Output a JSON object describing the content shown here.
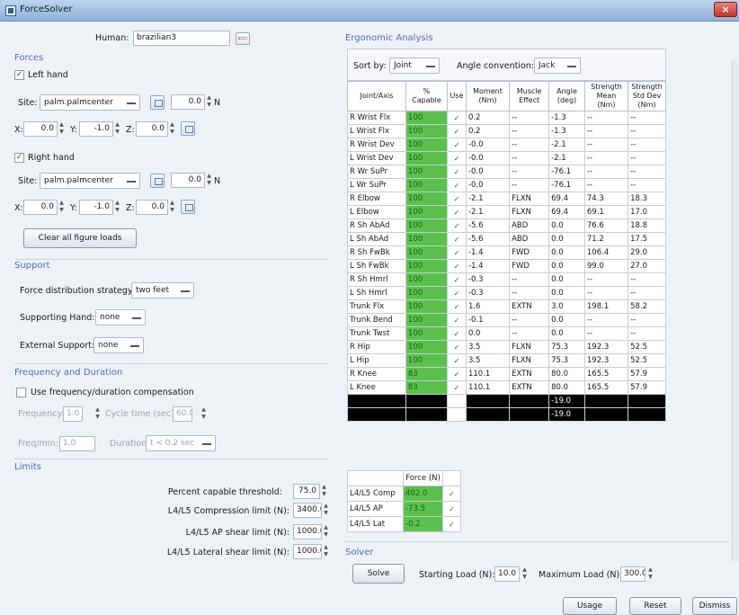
{
  "window": {
    "title": "ForceSolver",
    "close_glyph": "×"
  },
  "human": {
    "label": "Human:",
    "value": "brazilian3"
  },
  "forces": {
    "section": "Forces",
    "left_hand": {
      "label": "Left hand",
      "checked": true,
      "site_label": "Site:",
      "site": "palm.palmcenter",
      "force": "0.0",
      "unit": "N",
      "x_label": "X:",
      "x": "0.0",
      "y_label": "Y:",
      "y": "-1.0",
      "z_label": "Z:",
      "z": "0.0"
    },
    "right_hand": {
      "label": "Right hand",
      "checked": true,
      "site_label": "Site:",
      "site": "palm.palmcenter",
      "force": "0.0",
      "unit": "N",
      "x_label": "X:",
      "x": "0.0",
      "y_label": "Y:",
      "y": "-1.0",
      "z_label": "Z:",
      "z": "0.0"
    },
    "clear_button": "Clear all figure loads"
  },
  "support": {
    "section": "Support",
    "strategy_label": "Force distribution strategy:",
    "strategy": "two feet",
    "hand_label": "Supporting Hand:",
    "hand": "none",
    "external_label": "External Support:",
    "external": "none"
  },
  "frequency": {
    "section": "Frequency and Duration",
    "use_label": "Use frequency/duration compensation",
    "frequency_label": "Frequency:",
    "frequency": "1.0",
    "cycle_label": "Cycle time (sec):",
    "cycle": "60.0",
    "freq_min_label": "Freq/min:",
    "freq_min": "1.0",
    "duration_label": "Duration:",
    "duration": "t < 0.2 sec"
  },
  "limits": {
    "section": "Limits",
    "threshold_label": "Percent capable threshold:",
    "threshold": "75.0",
    "compression_label": "L4/L5 Compression limit (N):",
    "compression": "3400.0",
    "ap_label": "L4/L5 AP shear limit (N):",
    "ap": "1000.0",
    "lateral_label": "L4/L5 Lateral shear limit (N):",
    "lateral": "1000.0"
  },
  "ergonomic": {
    "section": "Ergonomic Analysis",
    "sort_label": "Sort by:",
    "sort": "Joint",
    "angle_label": "Angle convention:",
    "angle": "Jack",
    "headers": [
      "Joint/Axis",
      "% Capable",
      "Use",
      "Moment (Nm)",
      "Muscle Effect",
      "Angle (deg)",
      "Strength Mean (Nm)",
      "Strength Std Dev (Nm)"
    ],
    "rows": [
      [
        "R Wrist Flx",
        "100",
        "✓",
        "0.2",
        "--",
        "-1.3",
        "--",
        "--"
      ],
      [
        "L Wrist Flx",
        "100",
        "✓",
        "0.2",
        "--",
        "-1.3",
        "--",
        "--"
      ],
      [
        "R Wrist Dev",
        "100",
        "✓",
        "-0.0",
        "--",
        "-2.1",
        "--",
        "--"
      ],
      [
        "L Wrist Dev",
        "100",
        "✓",
        "-0.0",
        "--",
        "-2.1",
        "--",
        "--"
      ],
      [
        "R Wr SuPr",
        "100",
        "✓",
        "-0.0",
        "--",
        "-76.1",
        "--",
        "--"
      ],
      [
        "L Wr SuPr",
        "100",
        "✓",
        "-0.0",
        "--",
        "-76.1",
        "--",
        "--"
      ],
      [
        "R Elbow",
        "100",
        "✓",
        "-2.1",
        "FLXN",
        "69.4",
        "74.3",
        "18.3"
      ],
      [
        "L Elbow",
        "100",
        "✓",
        "-2.1",
        "FLXN",
        "69.4",
        "69.1",
        "17.0"
      ],
      [
        "R Sh AbAd",
        "100",
        "✓",
        "-5.6",
        "ABD",
        "0.0",
        "76.6",
        "18.8"
      ],
      [
        "L Sh AbAd",
        "100",
        "✓",
        "-5.6",
        "ABD",
        "0.0",
        "71.2",
        "17.5"
      ],
      [
        "R Sh FwBk",
        "100",
        "✓",
        "-1.4",
        "FWD",
        "0.0",
        "106.4",
        "29.0"
      ],
      [
        "L Sh FwBk",
        "100",
        "✓",
        "-1.4",
        "FWD",
        "0.0",
        "99.0",
        "27.0"
      ],
      [
        "R Sh Hmrl",
        "100",
        "✓",
        "-0.3",
        "--",
        "0.0",
        "--",
        "--"
      ],
      [
        "L Sh Hmrl",
        "100",
        "✓",
        "-0.3",
        "--",
        "0.0",
        "--",
        "--"
      ],
      [
        "Trunk Flx",
        "100",
        "✓",
        "1.6",
        "EXTN",
        "3.0",
        "198.1",
        "58.2"
      ],
      [
        "Trunk Bend",
        "100",
        "✓",
        "-0.1",
        "--",
        "0.0",
        "--",
        "--"
      ],
      [
        "Trunk Twst",
        "100",
        "✓",
        "0.0",
        "--",
        "0.0",
        "--",
        "--"
      ],
      [
        "R Hip",
        "100",
        "✓",
        "3.5",
        "FLXN",
        "75.3",
        "192.3",
        "52.5"
      ],
      [
        "L Hip",
        "100",
        "✓",
        "3.5",
        "FLXN",
        "75.3",
        "192.3",
        "52.5"
      ],
      [
        "R Knee",
        "83",
        "✓",
        "110.1",
        "EXTN",
        "80.0",
        "165.5",
        "57.9"
      ],
      [
        "L Knee",
        "83",
        "✓",
        "110.1",
        "EXTN",
        "80.0",
        "165.5",
        "57.9"
      ]
    ],
    "black_rows": [
      {
        "angle": "-19.0"
      },
      {
        "angle": "-19.0"
      }
    ],
    "force_header": "Force (N)",
    "force_rows": [
      [
        "L4/L5 Comp",
        "402.0",
        "✓"
      ],
      [
        "L4/L5 AP",
        "-73.5",
        "✓"
      ],
      [
        "L4/L5 Lat",
        "-0.2",
        "✓"
      ]
    ]
  },
  "solver": {
    "section": "Solver",
    "solve_button": "Solve",
    "start_label": "Starting Load (N):",
    "start": "10.0",
    "max_label": "Maximum Load (N):",
    "max": "300.0"
  },
  "footer": {
    "usage": "Usage",
    "reset": "Reset",
    "dismiss": "Dismiss"
  }
}
